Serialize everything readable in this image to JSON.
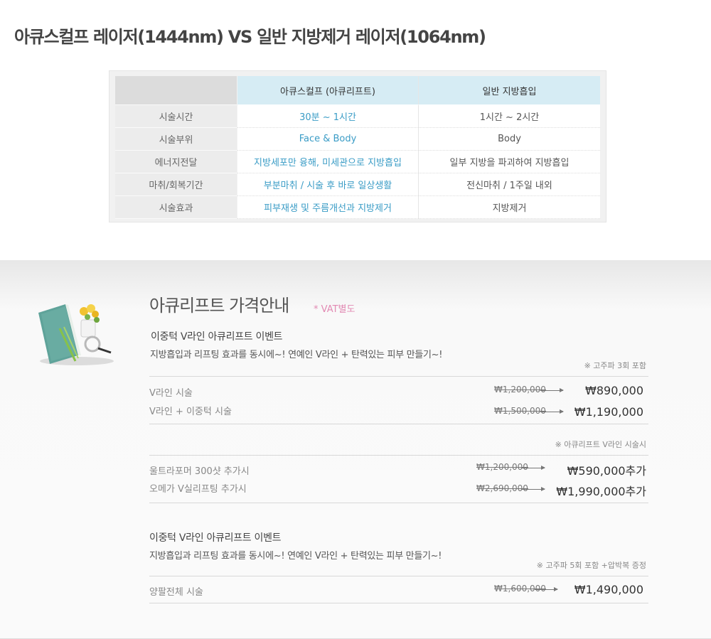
{
  "title": "아큐스컬프 레이저(1444nm) VS 일반 지방제거 레이저(1064nm)",
  "comparison": {
    "headers": [
      "",
      "아큐스컬프 (아큐리프트)",
      "일반 지방흡입"
    ],
    "rows": [
      {
        "label": "시술시간",
        "accu": "30분 ~ 1시간",
        "normal": "1시간 ~ 2시간"
      },
      {
        "label": "시술부위",
        "accu": "Face & Body",
        "normal": "Body"
      },
      {
        "label": "에너지전달",
        "accu": "지방세포만 융해, 미세관으로 지방흡입",
        "normal": "일부 지방을 파괴하여 지방흡입"
      },
      {
        "label": "마취/회복기간",
        "accu": "부분마취 / 시술 후 바로 일상생활",
        "normal": "전신마취 / 1주일 내외"
      },
      {
        "label": "시술효과",
        "accu": "피부재생 및 주름개선과 지방제거",
        "normal": "지방제거"
      }
    ]
  },
  "pricing": {
    "title": "아큐리프트 가격안내",
    "vat": "* VAT별도",
    "event1": {
      "title": "이중턱 V라인 아큐리프트 이벤트",
      "desc": "지방흡입과 리프팅 효과를 동시에~! 연예인 V라인 + 탄력있는 피부 만들기~!",
      "note": "※ 고주파 3회 포함",
      "items": [
        {
          "name": "V라인 시술",
          "original": "₩1,200,000",
          "price": "₩890,000"
        },
        {
          "name": "V라인 + 이중턱 시술",
          "original": "₩1,500,000",
          "price": "₩1,190,000"
        }
      ],
      "addon_note": "※ 아큐리프트 V라인 시술시",
      "addons": [
        {
          "name": "울트라포머 300샷 추가시",
          "original": "₩1,200,000",
          "price": "₩590,000추가"
        },
        {
          "name": "오메가 V실리프팅 추가시",
          "original": "₩2,690,000",
          "price": "₩1,990,000추가"
        }
      ]
    },
    "event2": {
      "title": "이중턱 V라인 아큐리프트 이벤트",
      "desc": "지방흡입과 리프팅 효과를 동시에~! 연예인 V라인 + 탄력있는 피부 만들기~!",
      "note": "※ 고주파 5회 포함 +압박복 증정",
      "items": [
        {
          "name": "양팔전체 시술",
          "original": "₩1,600,000",
          "price": "₩1,490,000"
        }
      ]
    }
  }
}
